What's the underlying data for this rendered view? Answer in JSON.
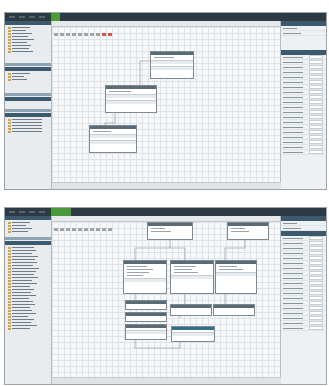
{
  "screens": [
    {
      "id": "screen-1",
      "menu": [
        "",
        "",
        "",
        ""
      ]
    },
    {
      "id": "screen-2",
      "menu": [
        "",
        "",
        "",
        ""
      ]
    }
  ],
  "colors": {
    "titlebar": "#2c3a44",
    "accent_green": "#4b9a3a",
    "panel_header": "#3c5a6e",
    "node_header": "#5b6b76",
    "selected_node_header": "#2f6f88",
    "canvas_bg": "#f6f8f9"
  },
  "icons": [
    "folder-icon",
    "flow-node-icon",
    "delete-icon",
    "toolbar-icon"
  ]
}
